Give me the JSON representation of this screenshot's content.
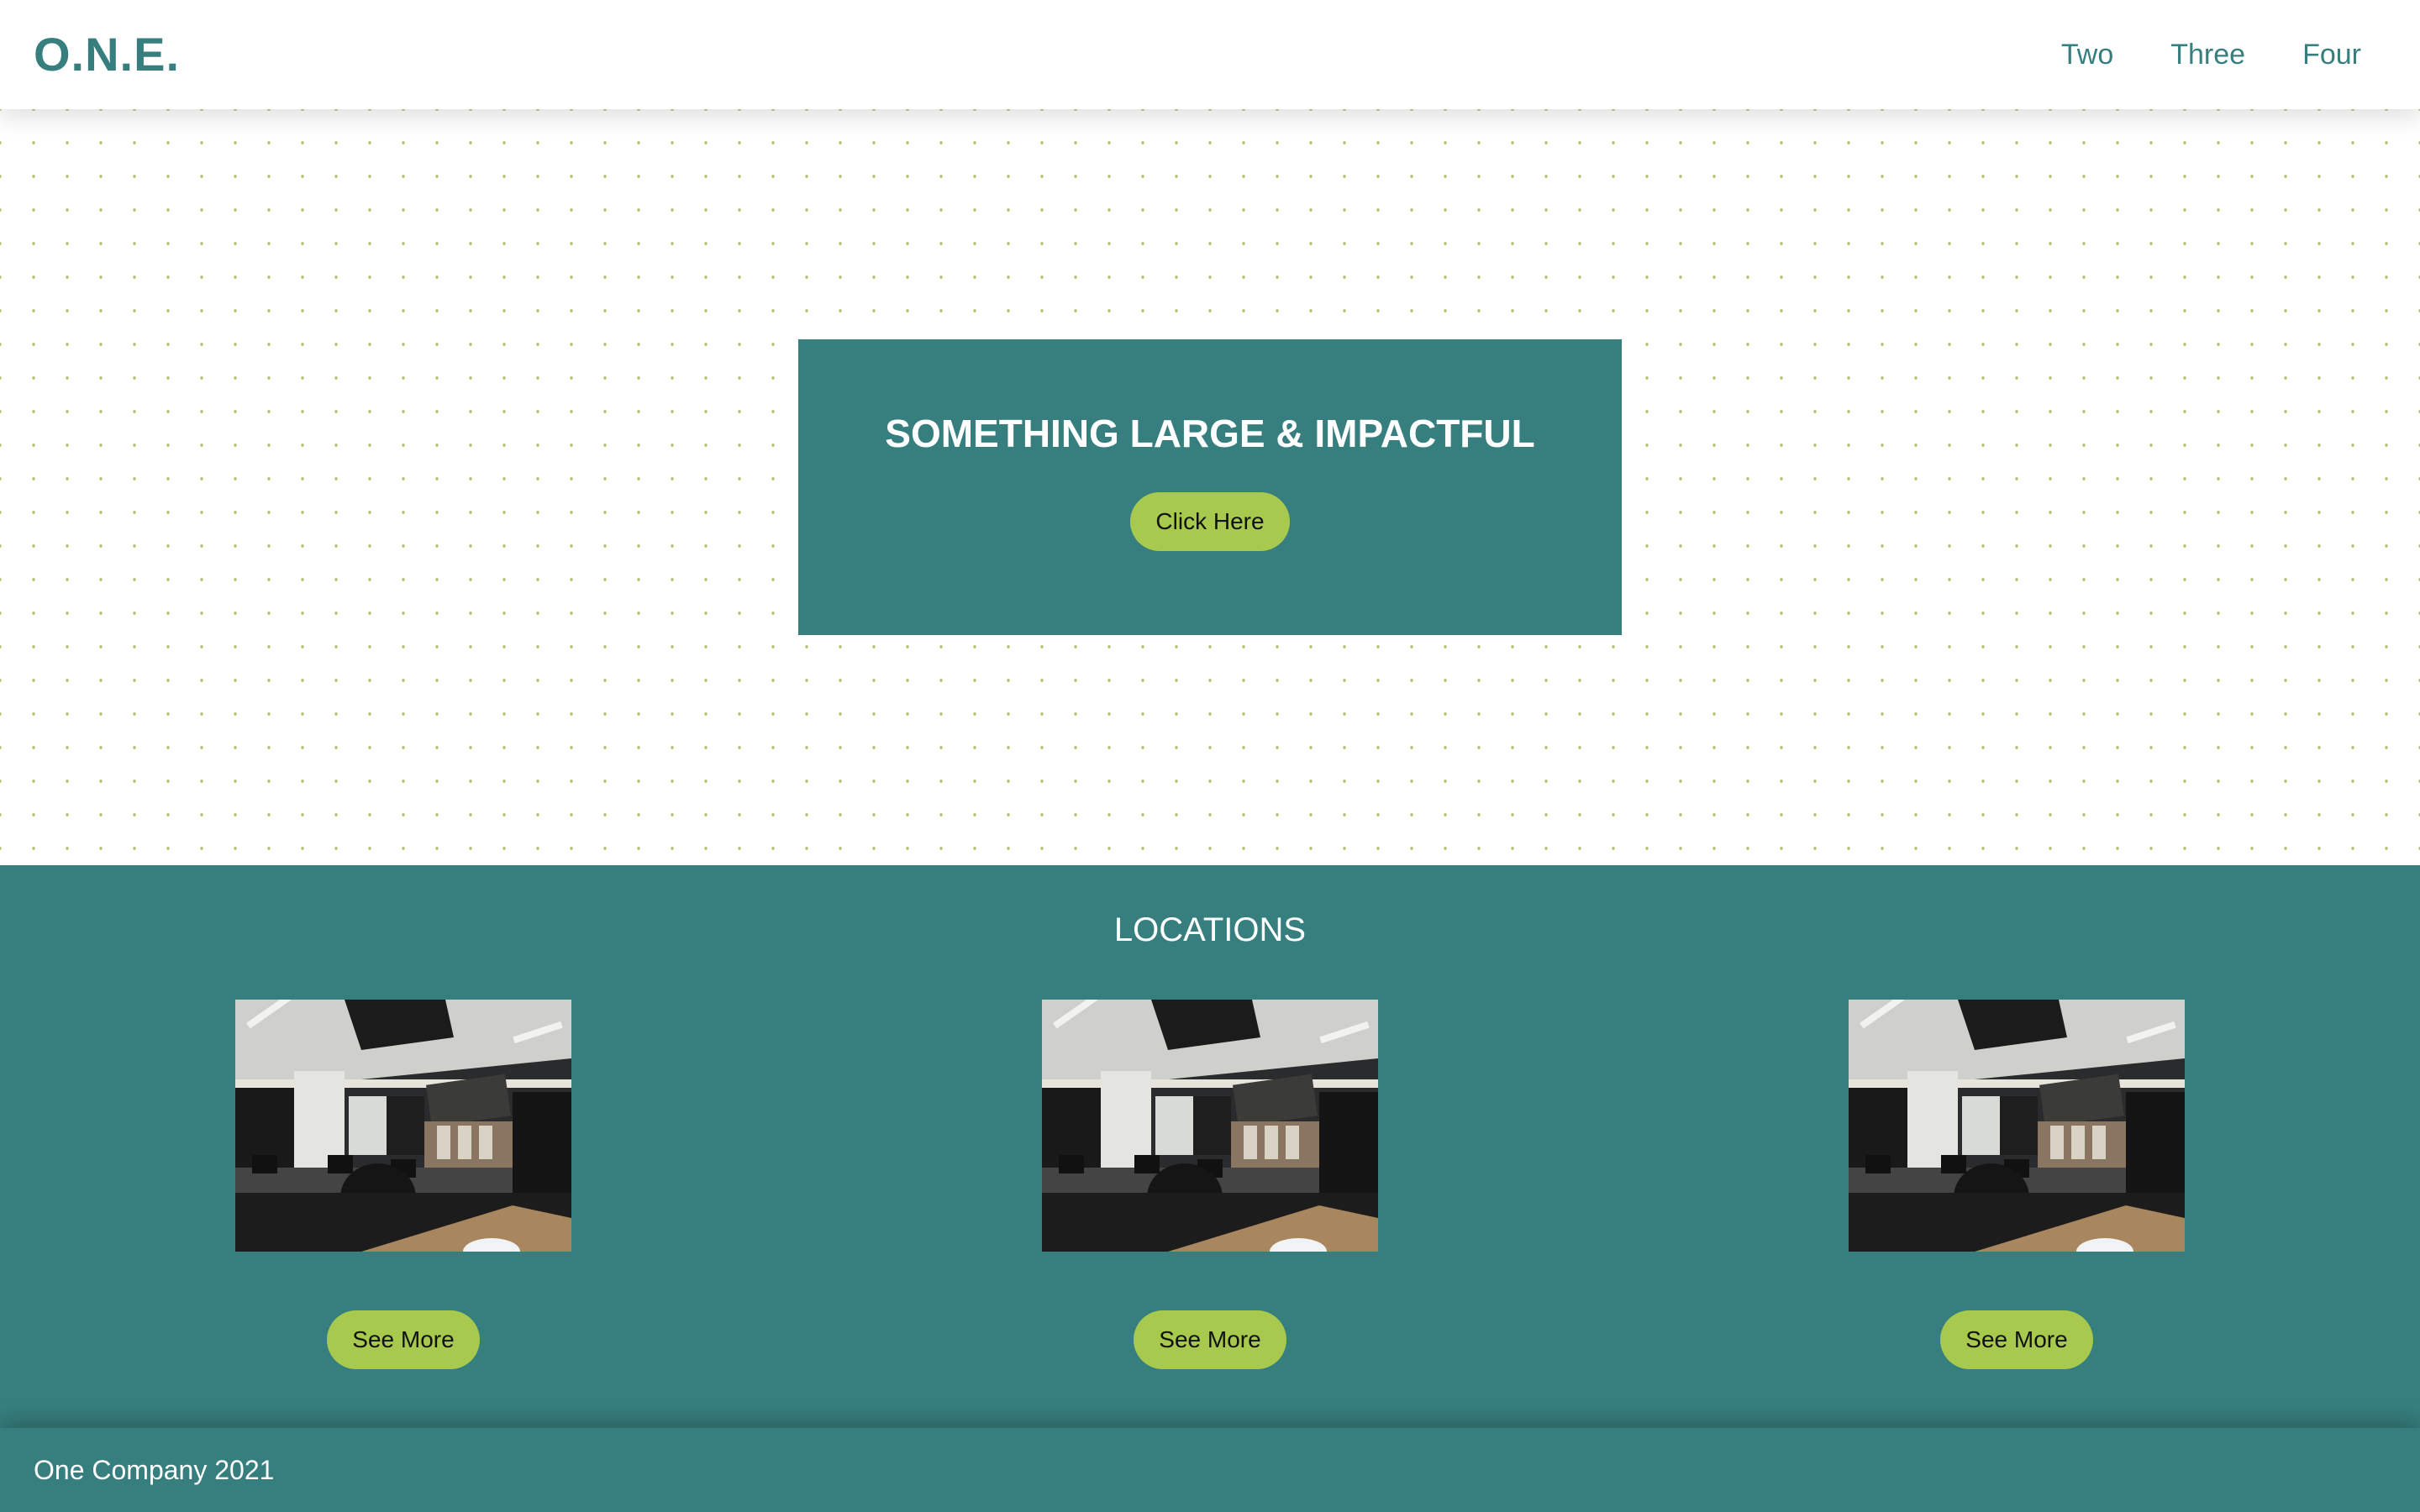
{
  "header": {
    "logo": "O.N.E.",
    "nav": [
      {
        "label": "Two"
      },
      {
        "label": "Three"
      },
      {
        "label": "Four"
      }
    ]
  },
  "hero": {
    "title": "SOMETHING LARGE & IMPACTFUL",
    "button_label": "Click Here"
  },
  "locations": {
    "title": "LOCATIONS",
    "cards": [
      {
        "button_label": "See More"
      },
      {
        "button_label": "See More"
      },
      {
        "button_label": "See More"
      }
    ]
  },
  "footer": {
    "text": "One Company 2021"
  },
  "colors": {
    "brand": "#377f7f",
    "accent": "#a7c94e",
    "dot": "#b9c870"
  }
}
